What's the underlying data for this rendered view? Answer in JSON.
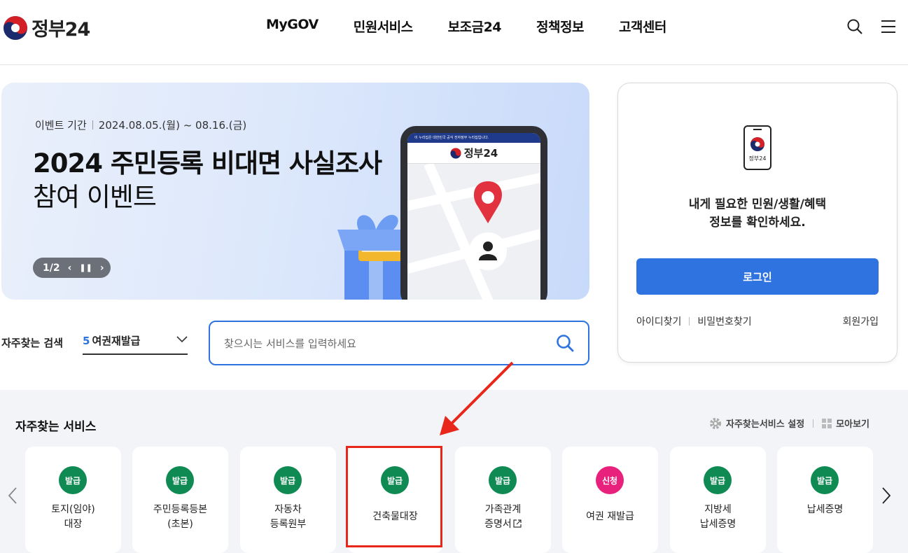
{
  "header": {
    "logo_text": "정부24",
    "nav": [
      "MyGOV",
      "민원서비스",
      "보조금24",
      "정책정보",
      "고객센터"
    ],
    "icons": [
      "search-icon",
      "menu-icon"
    ]
  },
  "banner": {
    "period_label": "이벤트 기간",
    "period_value": "2024.08.05.(월) ~ 08.16.(금)",
    "title_line1": "2024 주민등록 비대면 사실조사",
    "title_line2": "참여 이벤트",
    "pager": "1/2",
    "phone_app_text": "정부24",
    "phone_topbar": "이 누리집은 대한민국 공식 전자정부 누리집입니다."
  },
  "login": {
    "icon_caption": "정부24",
    "message_line1": "내게 필요한 민원/생활/혜택",
    "message_line2": "정보를 확인하세요.",
    "button": "로그인",
    "find_id": "아이디찾기",
    "find_pw": "비밀번호찾기",
    "signup": "회원가입"
  },
  "search": {
    "label": "자주찾는 검색",
    "selected_rank": "5",
    "selected_text": "여권재발급",
    "placeholder": "찾으시는 서비스를 입력하세요"
  },
  "services": {
    "title": "자주찾는 서비스",
    "settings_label": "자주찾는서비스 설정",
    "view_all_label": "모아보기",
    "cards": [
      {
        "badge": "발급",
        "line1": "토지(임야)",
        "line2": "대장"
      },
      {
        "badge": "발급",
        "line1": "주민등록등본",
        "line2": "(초본)"
      },
      {
        "badge": "발급",
        "line1": "자동차",
        "line2": "등록원부"
      },
      {
        "badge": "발급",
        "line1": "건축물대장",
        "line2": ""
      },
      {
        "badge": "발급",
        "line1": "가족관계",
        "line2": "증명서"
      },
      {
        "badge": "신청",
        "line1": "여권 재발급",
        "line2": ""
      },
      {
        "badge": "발급",
        "line1": "지방세",
        "line2": "납세증명"
      },
      {
        "badge": "발급",
        "line1": "납세증명",
        "line2": ""
      }
    ]
  },
  "colors": {
    "accent": "#2f73e0",
    "badge_green": "#0e8a52",
    "badge_pink": "#e8217d",
    "annotation_red": "#e8261a"
  }
}
